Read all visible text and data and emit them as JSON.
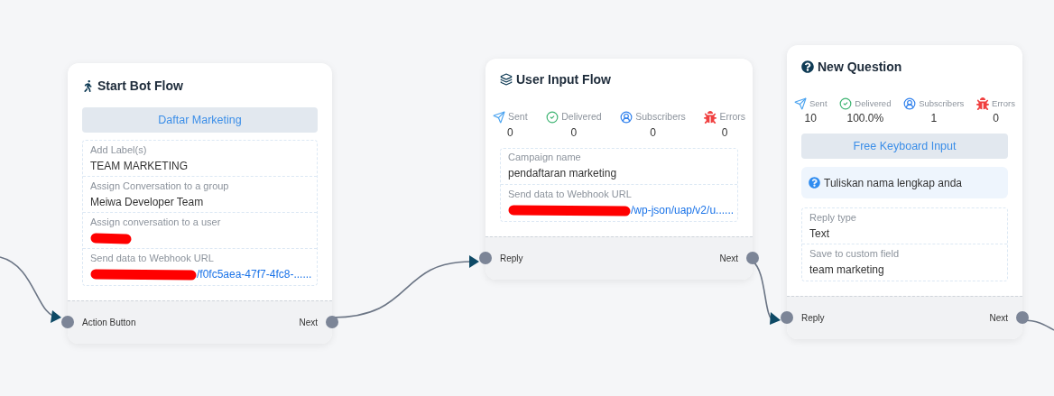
{
  "nodes": [
    {
      "kind": "start",
      "title": "Start Bot Flow",
      "button": "Daftar Marketing",
      "fields": [
        {
          "label": "Add Label(s)",
          "value": "TEAM MARKETING",
          "kind": "text",
          "redacted": false
        },
        {
          "label": "Assign Conversation to a group",
          "value": "Meiwa Developer Team",
          "kind": "text",
          "redacted": false
        },
        {
          "label": "Assign conversation to a user",
          "redacted": true
        },
        {
          "label": "Send data to Webhook URL",
          "value": "/f0fc5aea-47f7-4fc8-......",
          "kind": "link",
          "redacted": true
        }
      ],
      "input": "Action Button",
      "output": "Next"
    },
    {
      "kind": "user_input",
      "title": "User Input Flow",
      "stats": [
        {
          "kind": "sent",
          "label": "Sent",
          "value": "0"
        },
        {
          "kind": "delivered",
          "label": "Delivered",
          "value": "0"
        },
        {
          "kind": "subscribers",
          "label": "Subscribers",
          "value": "0"
        },
        {
          "kind": "errors",
          "label": "Errors",
          "value": "0"
        }
      ],
      "fields": [
        {
          "label": "Campaign name",
          "value": "pendaftaran marketing",
          "kind": "text",
          "redacted": false
        },
        {
          "label": "Send data to Webhook URL",
          "value": "/wp-json/uap/v2/u......",
          "kind": "link",
          "redacted": true
        }
      ],
      "input": "Reply",
      "output": "Next"
    },
    {
      "kind": "question",
      "title": "New Question",
      "stats": [
        {
          "kind": "sent",
          "label": "Sent",
          "value": "10"
        },
        {
          "kind": "delivered",
          "label": "Delivered",
          "value": "100.0%"
        },
        {
          "kind": "subscribers",
          "label": "Subscribers",
          "value": "1"
        },
        {
          "kind": "errors",
          "label": "Errors",
          "value": "0"
        }
      ],
      "button": "Free Keyboard Input",
      "question": "Tuliskan nama lengkap anda",
      "fields": [
        {
          "label": "Reply type",
          "value": "Text",
          "kind": "text",
          "redacted": false
        },
        {
          "label": "Save to custom field",
          "value": "team marketing",
          "kind": "text",
          "redacted": false
        }
      ],
      "input": "Reply",
      "output": "Next"
    }
  ]
}
